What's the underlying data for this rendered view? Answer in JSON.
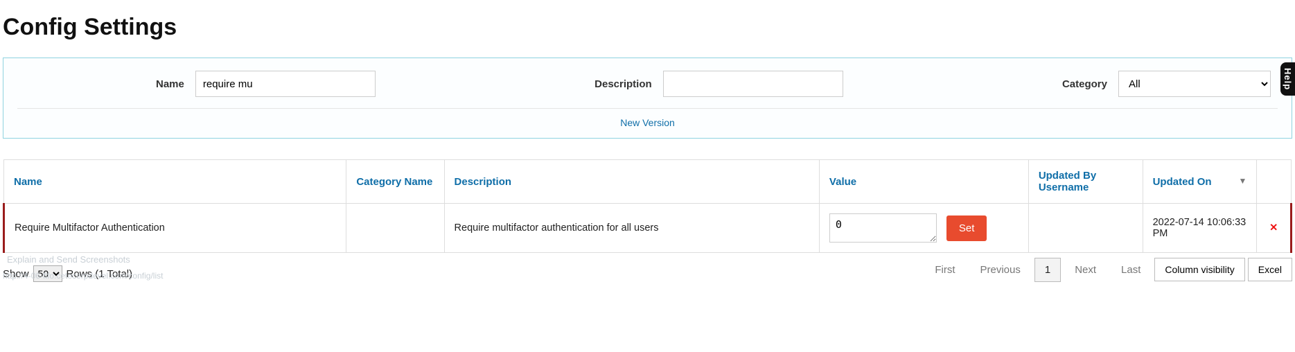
{
  "page": {
    "title": "Config Settings"
  },
  "help": {
    "label": "Help"
  },
  "filters": {
    "name": {
      "label": "Name",
      "value": "require mu"
    },
    "description": {
      "label": "Description",
      "value": ""
    },
    "category": {
      "label": "Category",
      "selected": "All"
    },
    "new_version_link": "New Version"
  },
  "table": {
    "headers": {
      "name": "Name",
      "category_name": "Category Name",
      "description": "Description",
      "value": "Value",
      "updated_by": "Updated By Username",
      "updated_on": "Updated On"
    },
    "rows": [
      {
        "name": "Require Multifactor Authentication",
        "category_name": "",
        "description": "Require multifactor authentication for all users",
        "value": "0",
        "set_label": "Set",
        "updated_by": "",
        "updated_on": "2022-07-14 10:06:33 PM",
        "delete_label": "✕"
      }
    ]
  },
  "footer": {
    "ghost_link_text": "Explain and Send Screenshots",
    "ghost_url": "http://4-06-fifo.cetecerpdevel.com/config/list",
    "show_label": "Show",
    "show_value": "50",
    "rows_label": "Rows  (1 Total)",
    "pager": {
      "first": "First",
      "previous": "Previous",
      "current": "1",
      "next": "Next",
      "last": "Last"
    },
    "column_visibility": "Column visibility",
    "excel": "Excel"
  }
}
